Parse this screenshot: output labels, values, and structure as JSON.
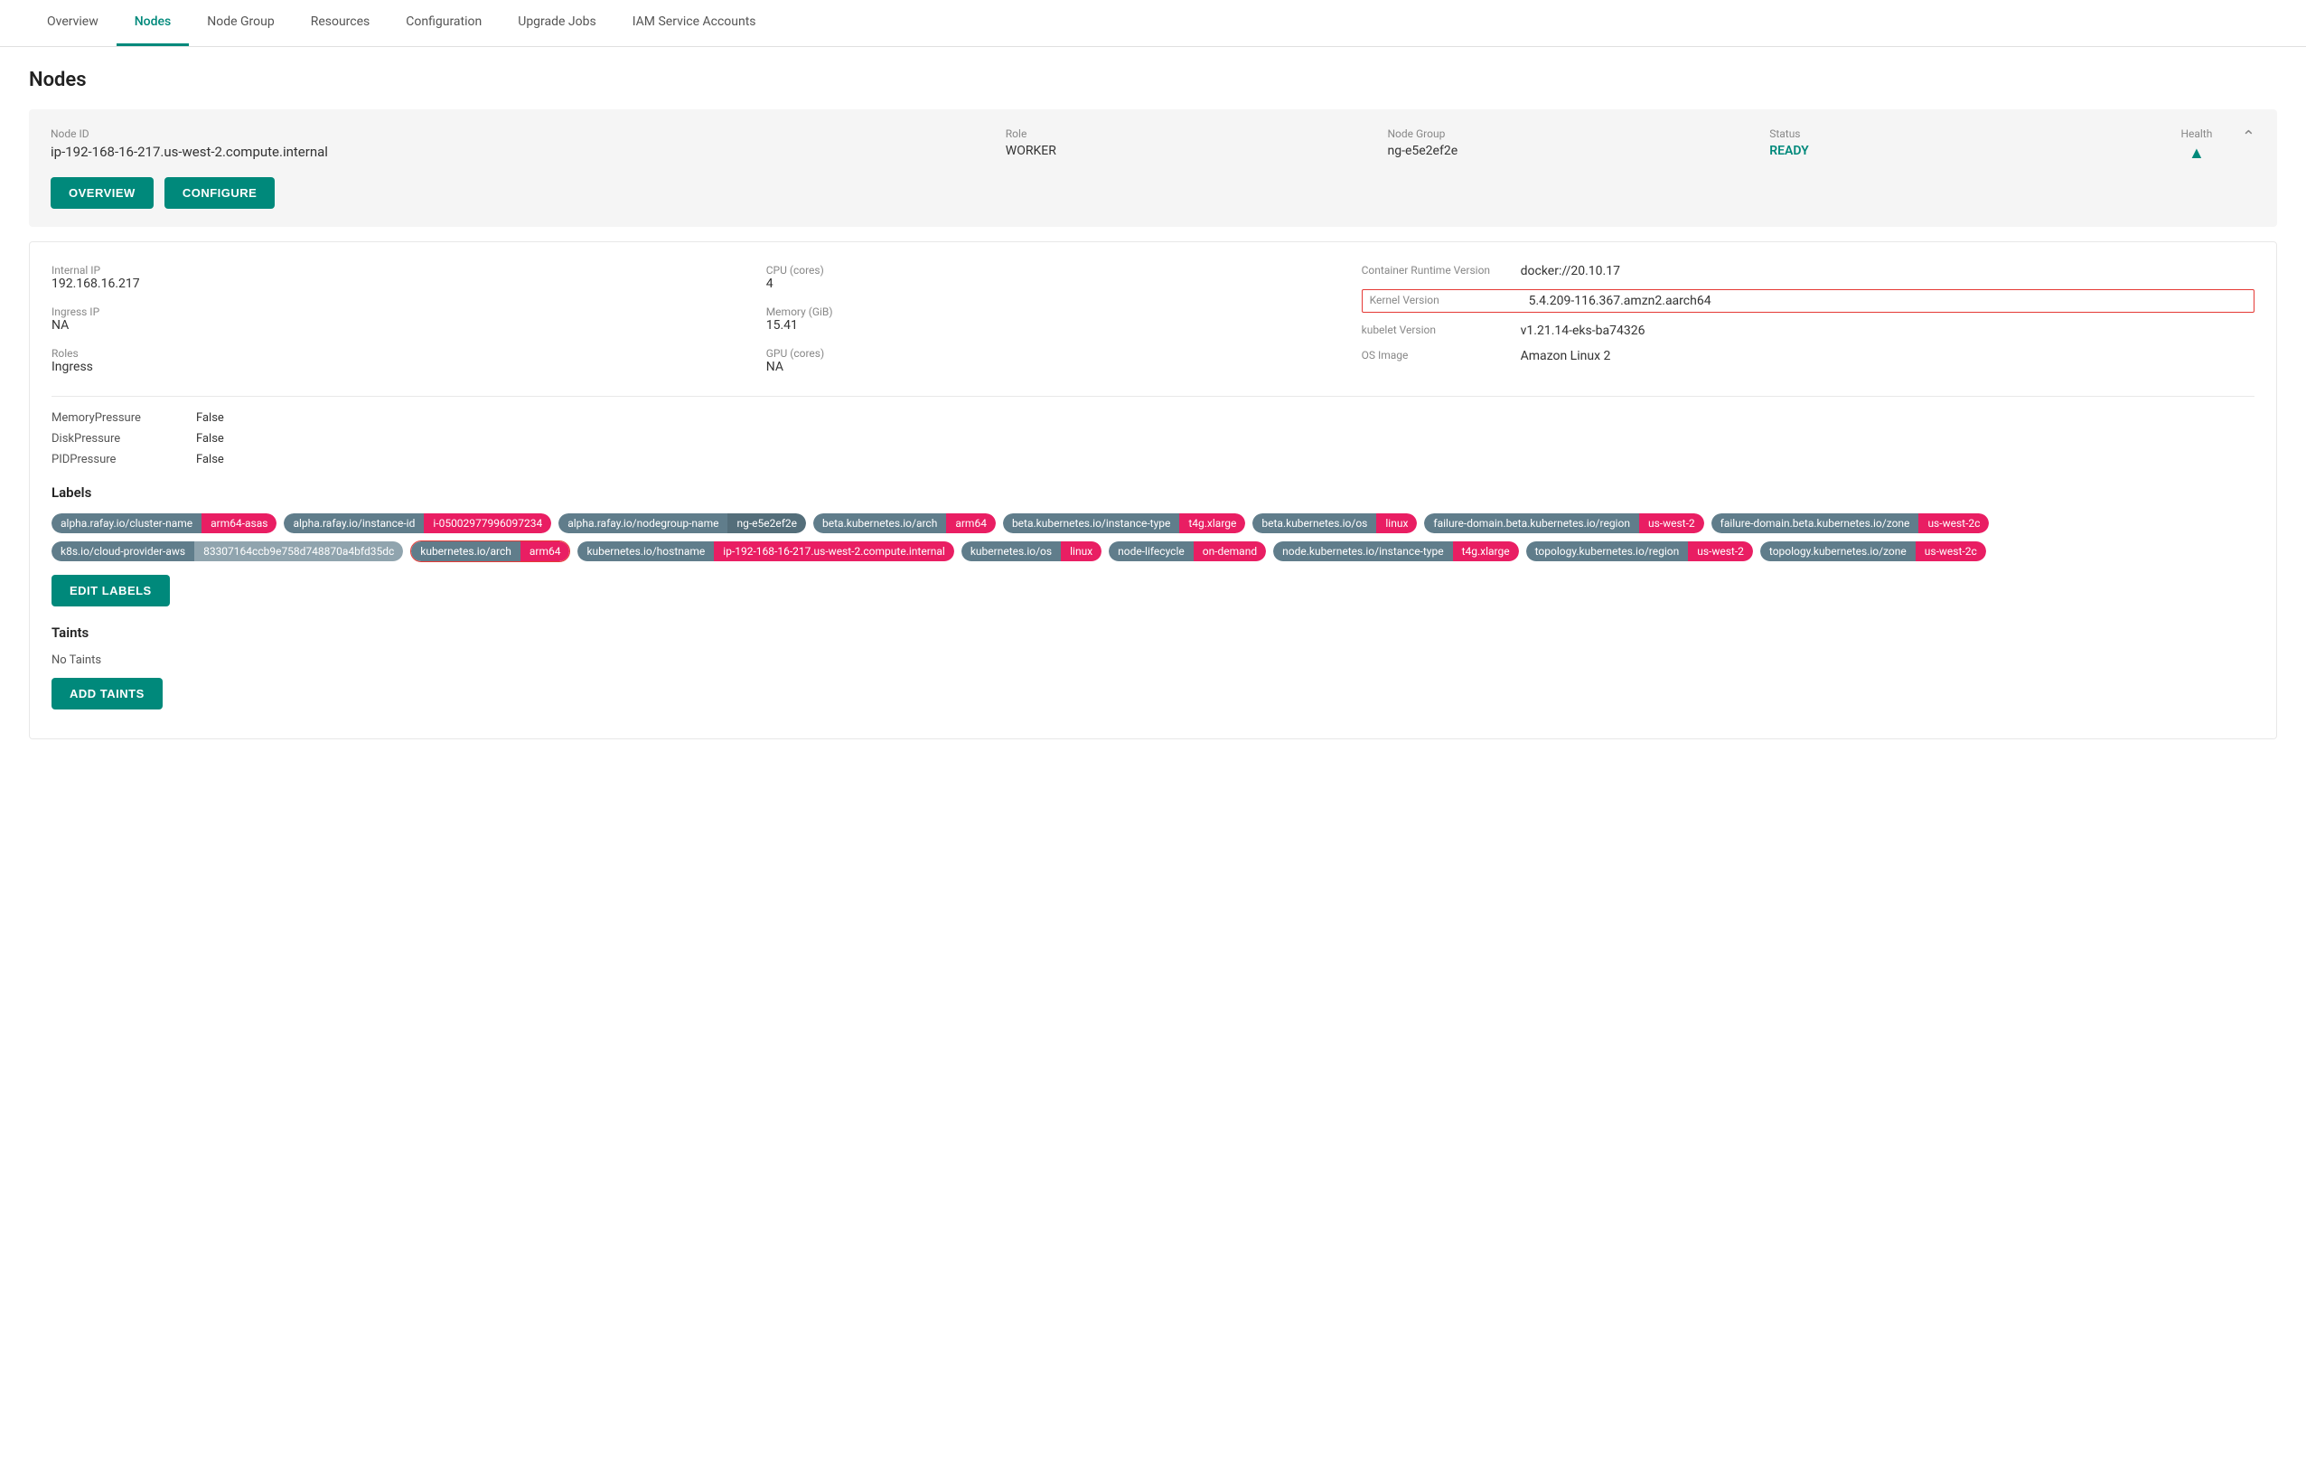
{
  "nav": {
    "tabs": [
      {
        "label": "Overview",
        "active": false
      },
      {
        "label": "Nodes",
        "active": true
      },
      {
        "label": "Node Group",
        "active": false
      },
      {
        "label": "Resources",
        "active": false
      },
      {
        "label": "Configuration",
        "active": false
      },
      {
        "label": "Upgrade Jobs",
        "active": false
      },
      {
        "label": "IAM Service Accounts",
        "active": false
      }
    ]
  },
  "page": {
    "title": "Nodes"
  },
  "node": {
    "id_label": "Node ID",
    "id_value": "ip-192-168-16-217.us-west-2.compute.internal",
    "role_label": "Role",
    "role_value": "WORKER",
    "group_label": "Node Group",
    "group_value": "ng-e5e2ef2e",
    "status_label": "Status",
    "status_value": "READY",
    "health_label": "Health",
    "health_icon": "▲",
    "btn_overview": "OVERVIEW",
    "btn_configure": "CONFIGURE"
  },
  "details": {
    "internal_ip_label": "Internal IP",
    "internal_ip_value": "192.168.16.217",
    "ingress_ip_label": "Ingress IP",
    "ingress_ip_value": "NA",
    "roles_label": "Roles",
    "roles_value": "Ingress",
    "cpu_label": "CPU (cores)",
    "cpu_value": "4",
    "memory_label": "Memory (GiB)",
    "memory_value": "15.41",
    "gpu_label": "GPU (cores)",
    "gpu_value": "NA",
    "container_runtime_label": "Container Runtime Version",
    "container_runtime_value": "docker://20.10.17",
    "kernel_label": "Kernel Version",
    "kernel_value": "5.4.209-116.367.amzn2.aarch64",
    "kubelet_label": "kubelet Version",
    "kubelet_value": "v1.21.14-eks-ba74326",
    "os_image_label": "OS Image",
    "os_image_value": "Amazon Linux 2"
  },
  "pressures": [
    {
      "label": "MemoryPressure",
      "value": "False"
    },
    {
      "label": "DiskPressure",
      "value": "False"
    },
    {
      "label": "PIDPressure",
      "value": "False"
    }
  ],
  "labels_title": "Labels",
  "labels": [
    {
      "key": "alpha.rafay.io/cluster-name",
      "val": "arm64-asas",
      "val_class": ""
    },
    {
      "key": "alpha.rafay.io/instance-id",
      "val": "i-05002977996097234",
      "val_class": ""
    },
    {
      "key": "alpha.rafay.io/nodegroup-name",
      "val": "ng-e5e2ef2e",
      "val_class": "dark"
    },
    {
      "key": "beta.kubernetes.io/arch",
      "val": "arm64",
      "val_class": ""
    },
    {
      "key": "beta.kubernetes.io/instance-type",
      "val": "t4g.xlarge",
      "val_class": ""
    },
    {
      "key": "beta.kubernetes.io/os",
      "val": "linux",
      "val_class": ""
    },
    {
      "key": "failure-domain.beta.kubernetes.io/region",
      "val": "us-west-2",
      "val_class": ""
    },
    {
      "key": "failure-domain.beta.kubernetes.io/zone",
      "val": "us-west-2c",
      "val_class": ""
    },
    {
      "key": "k8s.io/cloud-provider-aws",
      "val": "83307164ccb9e758d748870a4bfd35dc",
      "val_class": "gray"
    },
    {
      "key": "kubernetes.io/arch",
      "val": "arm64",
      "val_class": "",
      "highlighted": true
    },
    {
      "key": "kubernetes.io/hostname",
      "val": "ip-192-168-16-217.us-west-2.compute.internal",
      "val_class": ""
    },
    {
      "key": "kubernetes.io/os",
      "val": "linux",
      "val_class": ""
    },
    {
      "key": "node-lifecycle",
      "val": "on-demand",
      "val_class": ""
    },
    {
      "key": "node.kubernetes.io/instance-type",
      "val": "t4g.xlarge",
      "val_class": ""
    },
    {
      "key": "topology.kubernetes.io/region",
      "val": "us-west-2",
      "val_class": ""
    },
    {
      "key": "topology.kubernetes.io/zone",
      "val": "us-west-2c",
      "val_class": ""
    }
  ],
  "btn_edit_labels": "EDIT LABELS",
  "taints_title": "Taints",
  "no_taints_text": "No Taints",
  "btn_add_taints": "ADD TAINTS"
}
